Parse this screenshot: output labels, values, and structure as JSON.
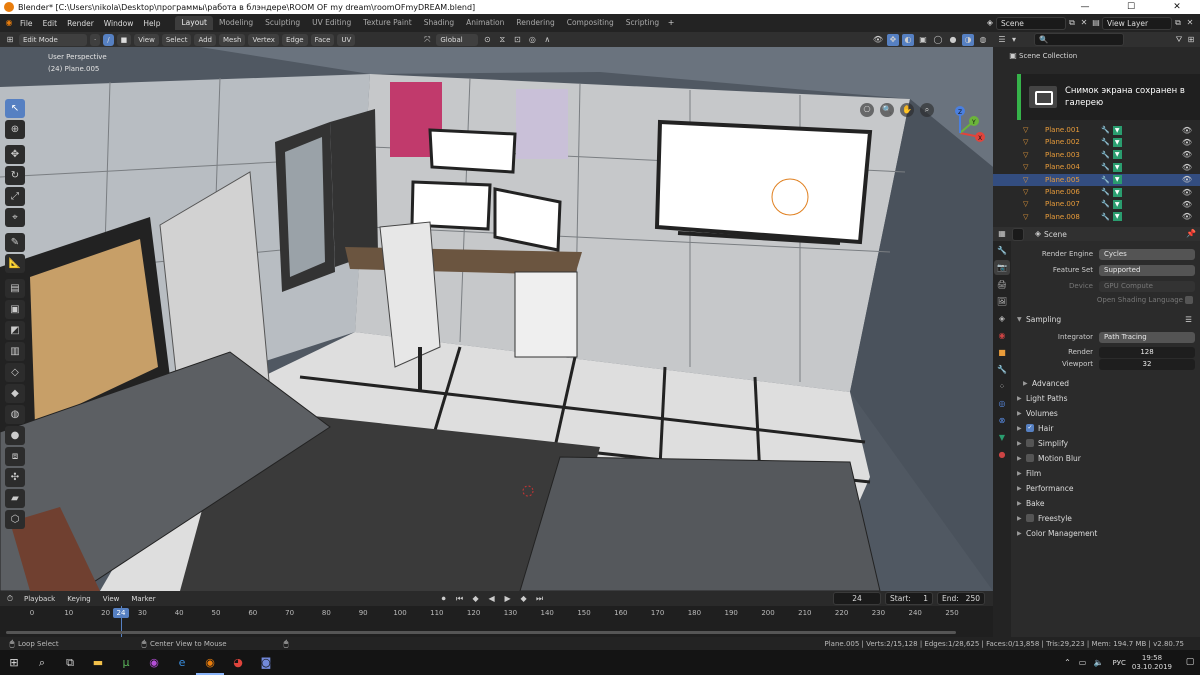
{
  "window": {
    "title": "Blender* [C:\\Users\\nikola\\Desktop\\программы\\работа в блэндере\\ROOM OF my dream\\roomOFmyDREAM.blend]",
    "controls": [
      "—",
      "☐",
      "✕"
    ]
  },
  "menus": [
    "File",
    "Edit",
    "Render",
    "Window",
    "Help"
  ],
  "workspaces": [
    {
      "label": "Layout",
      "active": true
    },
    {
      "label": "Modeling",
      "active": false
    },
    {
      "label": "Sculpting",
      "active": false
    },
    {
      "label": "UV Editing",
      "active": false
    },
    {
      "label": "Texture Paint",
      "active": false
    },
    {
      "label": "Shading",
      "active": false
    },
    {
      "label": "Animation",
      "active": false
    },
    {
      "label": "Rendering",
      "active": false
    },
    {
      "label": "Compositing",
      "active": false
    },
    {
      "label": "Scripting",
      "active": false
    }
  ],
  "scene_selector": "Scene",
  "view_layer": "View Layer",
  "viewport_header": {
    "mode": "Edit Mode",
    "menus": [
      "View",
      "Select",
      "Add",
      "Mesh",
      "Vertex",
      "Edge",
      "Face",
      "UV"
    ],
    "transform": "Global"
  },
  "viewport": {
    "perspective": "User Perspective",
    "object": "(24) Plane.005",
    "gizmo_axes": [
      "X",
      "Y",
      "Z"
    ]
  },
  "tools": [
    "select-icon",
    "cursor-icon",
    "move-icon",
    "rotate-icon",
    "scale-icon",
    "transform-icon",
    "annotate-icon",
    "measure-icon",
    "extrude-icon",
    "inset-icon",
    "bevel-icon",
    "loopcut-icon",
    "knife-icon",
    "polybuild-icon",
    "spin-icon",
    "smooth-icon",
    "edgeslide-icon",
    "shrink-icon",
    "shear-icon",
    "rip-icon"
  ],
  "outliner": {
    "title": "Scene Collection",
    "items": [
      {
        "name": "Plane.001",
        "selected": false
      },
      {
        "name": "Plane.002",
        "selected": false
      },
      {
        "name": "Plane.003",
        "selected": false
      },
      {
        "name": "Plane.004",
        "selected": false
      },
      {
        "name": "Plane.005",
        "selected": true
      },
      {
        "name": "Plane.006",
        "selected": false
      },
      {
        "name": "Plane.007",
        "selected": false
      },
      {
        "name": "Plane.008",
        "selected": false
      }
    ]
  },
  "toast": {
    "text": "Снимок экрана сохранен в галерею"
  },
  "properties": {
    "title": "Scene",
    "render_engine_label": "Render Engine",
    "render_engine": "Cycles",
    "feature_set_label": "Feature Set",
    "feature_set": "Supported",
    "device_label": "Device",
    "device": "GPU Compute",
    "osl_label": "Open Shading Language",
    "sampling_label": "Sampling",
    "integrator_label": "Integrator",
    "integrator": "Path Tracing",
    "render_label": "Render",
    "render_samples": 128,
    "viewport_label": "Viewport",
    "viewport_samples": 32,
    "advanced_label": "Advanced",
    "panels": [
      {
        "label": "Light Paths",
        "checkbox": null
      },
      {
        "label": "Volumes",
        "checkbox": null
      },
      {
        "label": "Hair",
        "checkbox": true
      },
      {
        "label": "Simplify",
        "checkbox": false
      },
      {
        "label": "Motion Blur",
        "checkbox": false
      },
      {
        "label": "Film",
        "checkbox": null
      },
      {
        "label": "Performance",
        "checkbox": null
      },
      {
        "label": "Bake",
        "checkbox": null
      },
      {
        "label": "Freestyle",
        "checkbox": false
      },
      {
        "label": "Color Management",
        "checkbox": null
      }
    ]
  },
  "timeline": {
    "menus": [
      "Playback",
      "Keying",
      "View",
      "Marker"
    ],
    "current_frame": 24,
    "start_label": "Start:",
    "start": 1,
    "end_label": "End:",
    "end": 250,
    "ticks": [
      0,
      10,
      20,
      30,
      40,
      50,
      60,
      70,
      80,
      90,
      100,
      110,
      120,
      130,
      140,
      150,
      160,
      170,
      180,
      190,
      200,
      210,
      220,
      230,
      240,
      250
    ]
  },
  "status": {
    "left": "Loop Select",
    "middle": "Center View to Mouse",
    "right": "Plane.005 | Verts:2/15,128 | Edges:1/28,625 | Faces:0/13,858 | Tris:29,223 | Mem: 194.7 MB | v2.80.75"
  },
  "taskbar": {
    "icons": [
      "windows-start-icon",
      "search-icon",
      "task-view-icon",
      "file-explorer-icon",
      "utorrent-icon",
      "media-player-icon",
      "edge-icon",
      "blender-icon",
      "chrome-icon",
      "discord-icon"
    ],
    "lang": "РУС",
    "time": "19:58",
    "date": "03.10.2019"
  },
  "colors": {
    "accent": "#5680c2",
    "object_orange": "#e99c3a",
    "mesh_green": "#2a9d6f",
    "toast_green": "#36b34a"
  }
}
